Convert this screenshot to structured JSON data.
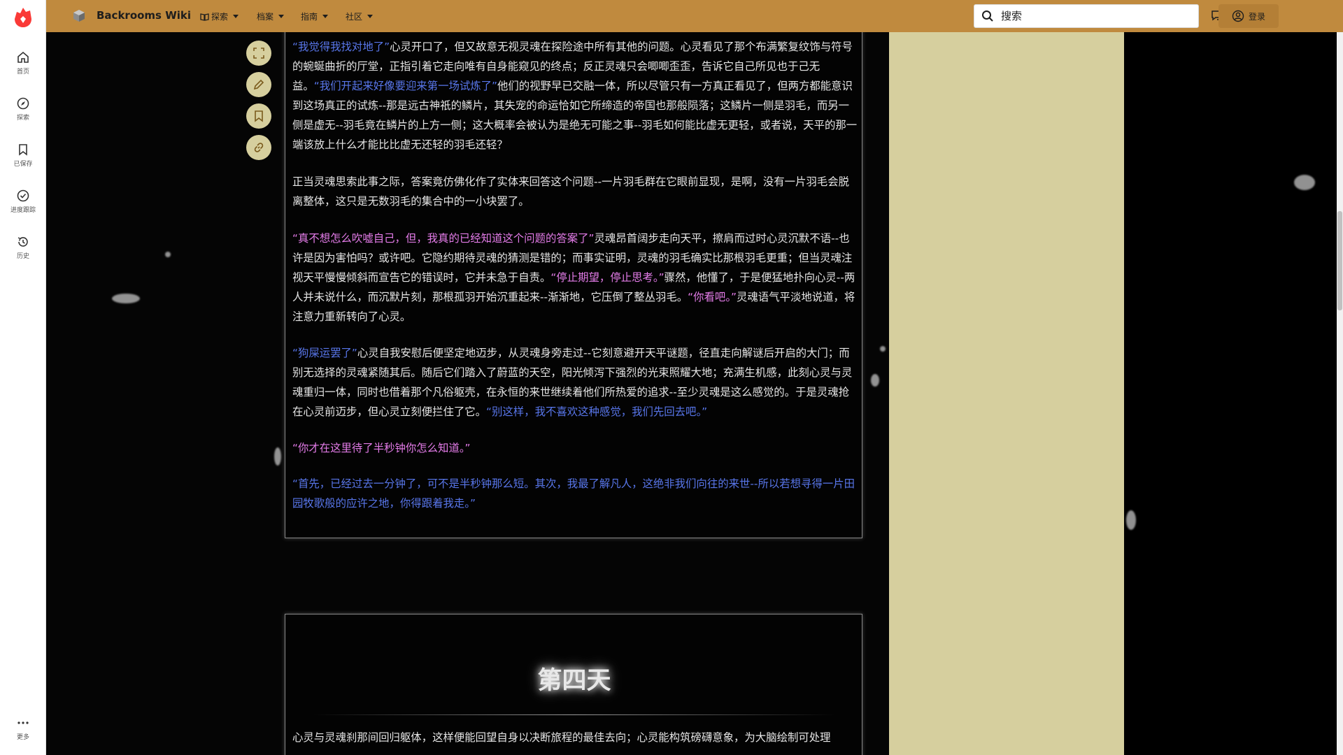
{
  "colors": {
    "topbar": "#c08a3e",
    "accent_panel": "#d6cf9e",
    "dialogue_blue": "#5876ea",
    "dialogue_pink": "#e47ce9",
    "brand_red": "#fa3a37"
  },
  "rail": {
    "items": [
      {
        "label": "首页",
        "icon": "home-icon"
      },
      {
        "label": "探索",
        "icon": "compass-icon"
      },
      {
        "label": "已保存",
        "icon": "bookmark-icon"
      },
      {
        "label": "进度跟踪",
        "icon": "check-circle-icon"
      },
      {
        "label": "历史",
        "icon": "history-icon"
      }
    ],
    "more_label": "更多"
  },
  "header": {
    "site_name": "Backrooms Wiki",
    "nav": [
      {
        "label": "探索"
      },
      {
        "label": "档案"
      },
      {
        "label": "指南"
      },
      {
        "label": "社区"
      }
    ],
    "search_placeholder": "搜索",
    "login_label": "登录"
  },
  "article": {
    "p1": {
      "q1": "“我觉得我找对地了”",
      "t1": "心灵开口了，但又故意无视灵魂在探险途中所有其他的问题。心灵看见了那个布满繁复纹饰与符号的蜿蜒曲折的厅堂，正指引着它走向唯有自身能窥见的终点；反正灵魂只会唧唧歪歪，告诉它自己所见也于己无益。",
      "q2": "“我们开起来好像要迎来第一场试炼了”",
      "t2": "他们的视野早已交融一体，所以尽管只有一方真正看见了，但两方都能意识到这场真正的试炼--那是远古神祇的鳞片，其失宠的命运恰如它所缔造的帝国也那般陨落；这鳞片一侧是羽毛，而另一侧是虚无--羽毛竟在鳞片的上方一侧；这大概率会被认为是绝无可能之事--羽毛如何能比虚无更轻，或者说，天平的那一端该放上什么才能比比虚无还轻的羽毛还轻？"
    },
    "p2": "正当灵魂思索此事之际，答案竟仿佛化作了实体来回答这个问题--一片羽毛群在它眼前显现，是啊，没有一片羽毛会脱离整体，这只是无数羽毛的集合中的一小块罢了。",
    "p3": {
      "q1": "“真不想怎么吹嘘自己，但，我真的已经知道这个问题的答案了”",
      "t1": "灵魂昂首阔步走向天平，擦肩而过时心灵沉默不语--也许是因为害怕吗？或许吧。它隐约期待灵魂的猜测是错的；而事实证明，灵魂的羽毛确实比那根羽毛更重；但当灵魂注视天平慢慢倾斜而宣告它的错误时，它并未急于自责。",
      "q2": "“停止期望，停止思考。”",
      "t2": "骤然，他懂了，于是便猛地扑向心灵--两人并未说什么，而沉默片刻，那根孤羽开始沉重起来--渐渐地，它压倒了整丛羽毛。",
      "q3": "“你看吧。”",
      "t3": "灵魂语气平淡地说道，将注意力重新转向了心灵。"
    },
    "p4": {
      "q1": "“狗屎运罢了”",
      "t1": "心灵自我安慰后便坚定地迈步，从灵魂身旁走过--它刻意避开天平谜题，径直走向解谜后开启的大门；而别无选择的灵魂紧随其后。随后它们踏入了蔚蓝的天空，阳光倾泻下强烈的光束照耀大地；充满生机感，此刻心灵与灵魂重归一体，同时也借着那个凡俗躯壳，在永恒的来世继续着他们所热爱的追求--至少灵魂是这么感觉的。于是灵魂抢在心灵前迈步，但心灵立刻便拦住了它。",
      "q2": "“别这样，我不喜欢这种感觉，我们先回去吧。”"
    },
    "p5": "“你才在这里待了半秒钟你怎么知道。”",
    "p6": "“首先，已经过去一分钟了，可不是半秒钟那么短。其次，我最了解凡人，这绝非我们向往的来世--所以若想寻得一片田园牧歌般的应许之地，你得跟着我走。”",
    "day_title": "第四天",
    "day_para": "心灵与灵魂刹那间回归躯体，这样便能回望自身以决断旅程的最佳去向；心灵能构筑磅礴意象，为大脑绘制可处理"
  }
}
